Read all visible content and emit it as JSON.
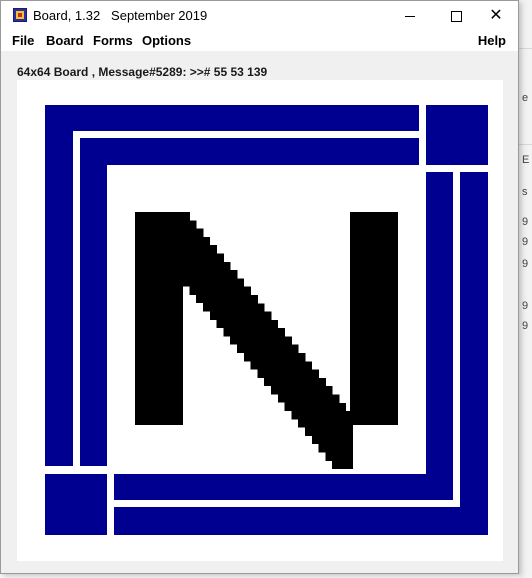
{
  "window": {
    "title": "Board, 1.32   September 2019",
    "controls": {
      "minimize": "minimize",
      "maximize": "maximize",
      "close": "✕"
    }
  },
  "menu": {
    "items": [
      "File",
      "Board",
      "Forms",
      "Options"
    ],
    "help": "Help"
  },
  "status": {
    "message": "64x64 Board , Message#5289: >># 55 53 139"
  },
  "board": {
    "letter": "N",
    "frame_color": "#000090",
    "letter_color": "#000000",
    "background_color": "#ffffff"
  },
  "background": {
    "fragments": [
      "e",
      "E",
      "s",
      "9",
      "9",
      "9",
      "9",
      "9"
    ]
  }
}
